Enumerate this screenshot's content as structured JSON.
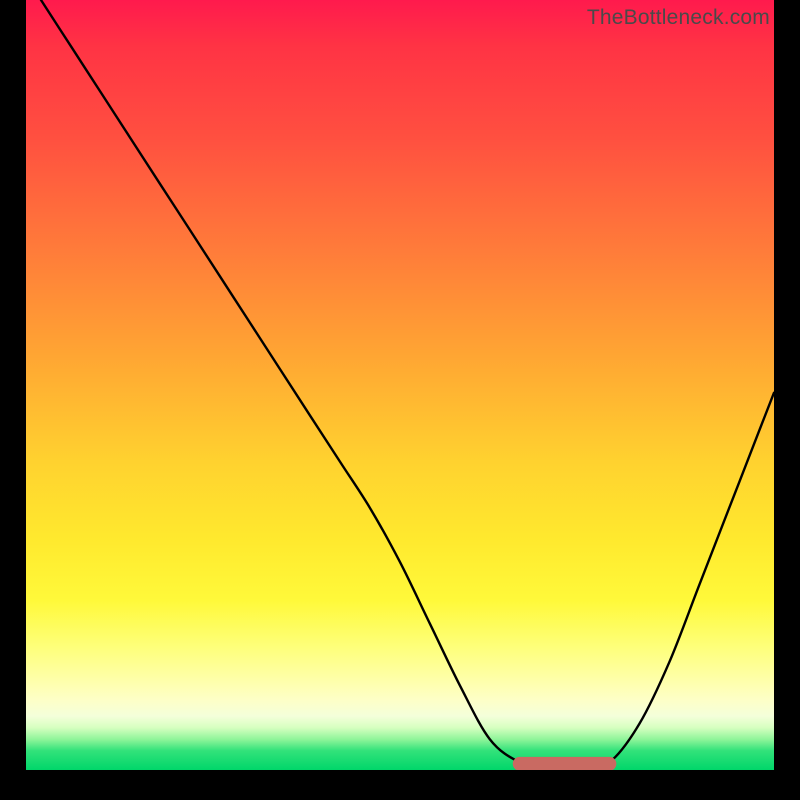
{
  "watermark": "TheBottleneck.com",
  "chart_data": {
    "type": "line",
    "title": "",
    "xlabel": "",
    "ylabel": "",
    "xlim": [
      0,
      100
    ],
    "ylim": [
      0,
      100
    ],
    "series": [
      {
        "name": "bottleneck-curve",
        "x": [
          2,
          6,
          10,
          14,
          18,
          22,
          26,
          30,
          34,
          38,
          42,
          46,
          50,
          54,
          58,
          62,
          66,
          70,
          74,
          78,
          82,
          86,
          90,
          94,
          98,
          100
        ],
        "y": [
          100,
          94,
          88,
          82,
          76,
          70,
          64,
          58,
          52,
          46,
          40,
          34,
          27,
          19,
          11,
          4,
          1,
          0,
          0,
          1,
          6,
          14,
          24,
          34,
          44,
          49
        ]
      }
    ],
    "annotations": [
      {
        "name": "optimal-band",
        "type": "segment",
        "x": [
          66,
          78
        ],
        "y": [
          0.8,
          0.8
        ],
        "color": "#c96a62",
        "thickness_pct": 1.8
      }
    ],
    "gradient_stops": [
      {
        "pct": 0,
        "color": "#ff1a4d"
      },
      {
        "pct": 46,
        "color": "#ffa533"
      },
      {
        "pct": 78,
        "color": "#fff93a"
      },
      {
        "pct": 100,
        "color": "#00d66a"
      }
    ]
  }
}
